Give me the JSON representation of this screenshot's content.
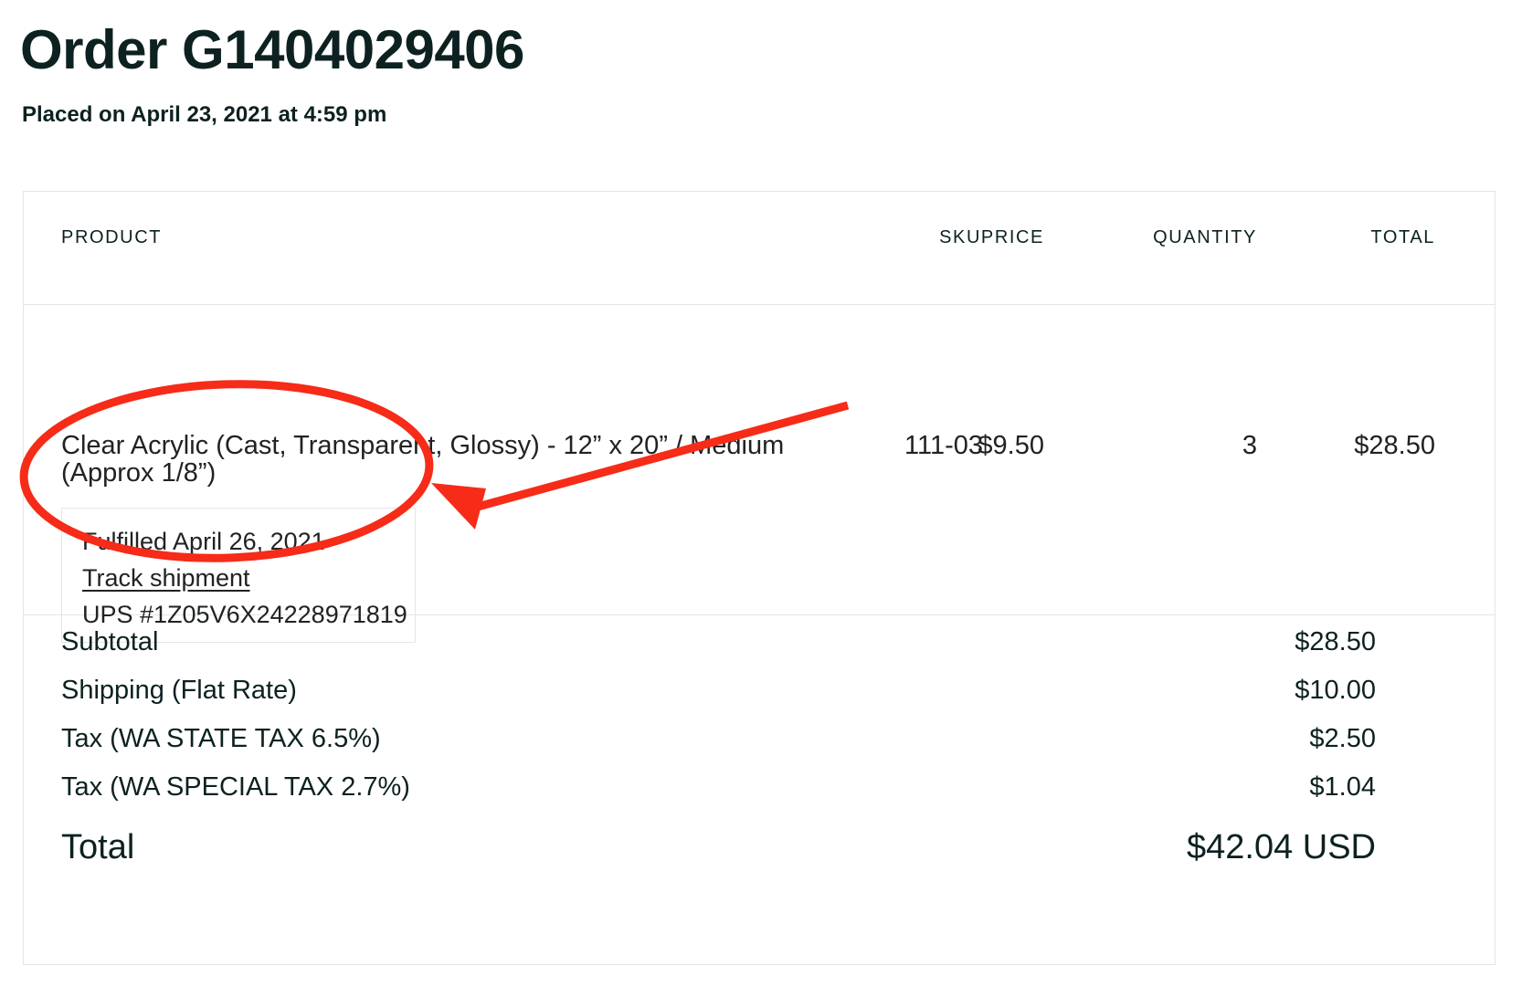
{
  "header": {
    "title": "Order G1404029406",
    "subtitle": "Placed on April 23, 2021 at 4:59 pm"
  },
  "table": {
    "columns": {
      "product": "PRODUCT",
      "sku": "SKU",
      "price": "PRICE",
      "quantity": "QUANTITY",
      "total": "TOTAL"
    },
    "items": [
      {
        "name_line1": "Clear Acrylic (Cast, Transparent, Glossy) - 12” x 20” / Medium",
        "name_line2": "(Approx 1/8”)",
        "sku": "111-03",
        "price": "$9.50",
        "quantity": "3",
        "total": "$28.50",
        "fulfillment": {
          "status": "Fulfilled April 26, 2021",
          "track_link": "Track shipment",
          "tracking_number": "UPS #1Z05V6X24228971819"
        }
      }
    ]
  },
  "summary": {
    "rows": [
      {
        "label": "Subtotal",
        "value": "$28.50"
      },
      {
        "label": "Shipping (Flat Rate)",
        "value": "$10.00"
      },
      {
        "label": "Tax (WA STATE TAX 6.5%)",
        "value": "$2.50"
      },
      {
        "label": "Tax (WA SPECIAL TAX 2.7%)",
        "value": "$1.04"
      }
    ],
    "total_label": "Total",
    "total_value": "$42.04 USD"
  },
  "annotation": {
    "ellipse_color": "#f62b18",
    "arrow_color": "#f62b18",
    "target": "fulfillment-details"
  },
  "colors": {
    "text": "#0d2121",
    "body_text": "#202223",
    "border": "#e3e5e5",
    "background": "#ffffff",
    "annotation_red": "#f62b18"
  }
}
